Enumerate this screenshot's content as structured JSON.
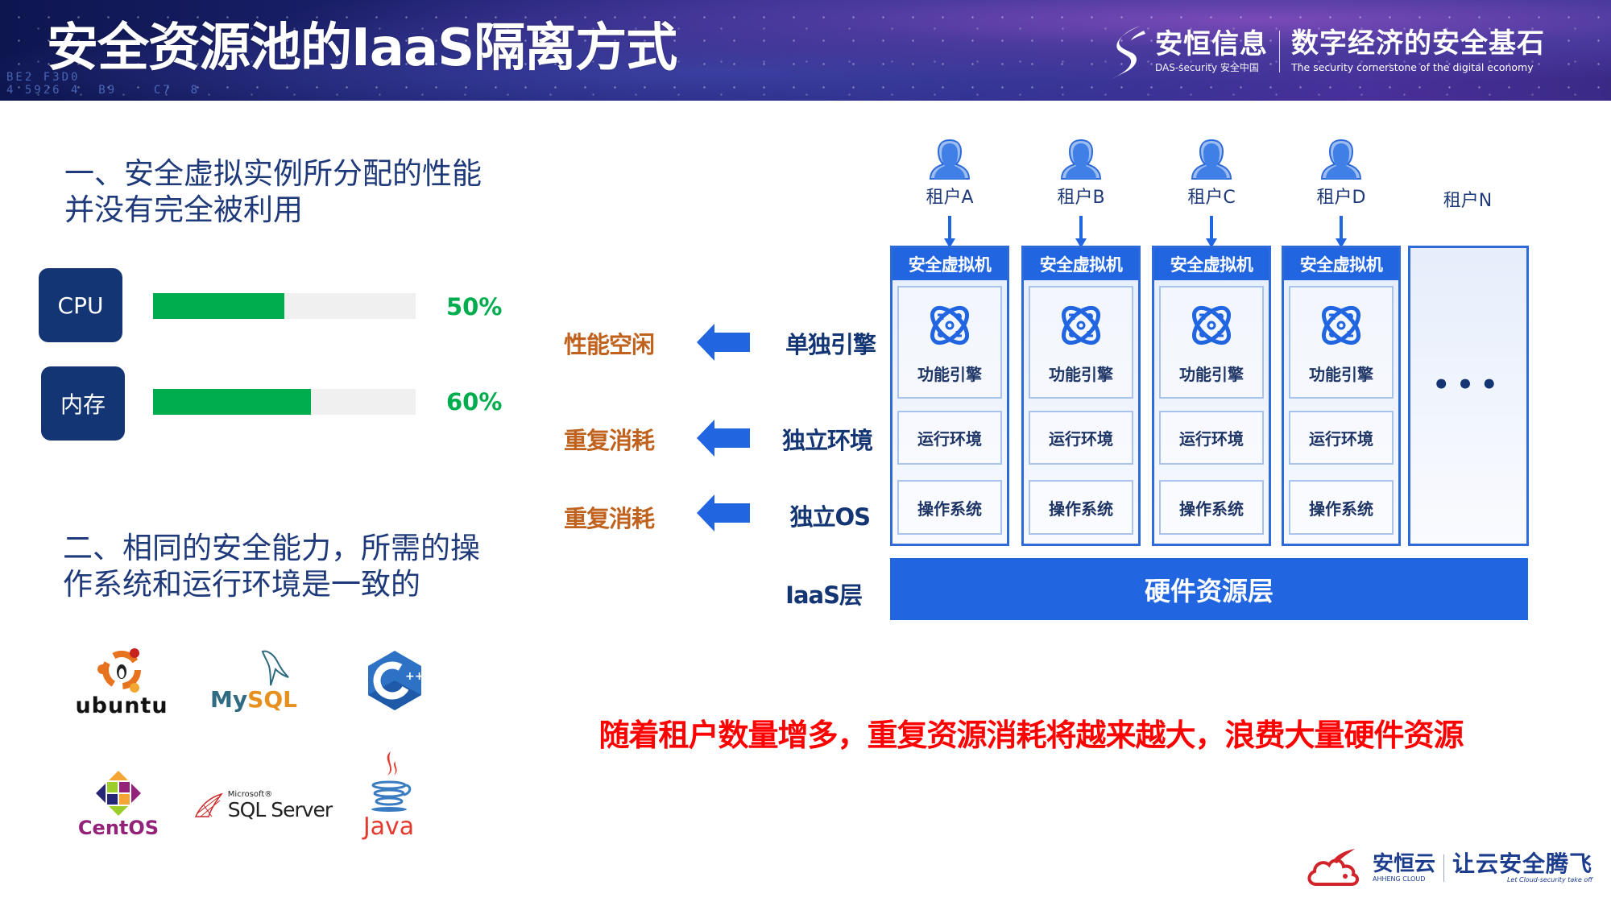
{
  "header": {
    "title": "安全资源池的IaaS隔离方式",
    "background_code": "BE2 F3D0\n4 5926 4  B9    C7  8",
    "brand": {
      "name": "安恒信息",
      "sub": "DAS-security 安全中国",
      "slogan": "数字经济的安全基石",
      "slogan_en": "The security cornerstone of the digital economy"
    }
  },
  "left": {
    "heading1": [
      "一、安全虚拟实例所分配的性能",
      "并没有完全被利用"
    ],
    "metrics": [
      {
        "label": "CPU",
        "value": 0.5,
        "value_text": "50%"
      },
      {
        "label": "内存",
        "value": 0.6,
        "value_text": "60%"
      }
    ],
    "heading2": [
      "二、相同的安全能力，所需的操",
      "作系统和运行环境是一致的"
    ],
    "logos": [
      {
        "name": "ubuntu",
        "text": "ubuntu"
      },
      {
        "name": "mysql",
        "text_a": "My",
        "text_b": "SQL"
      },
      {
        "name": "cpp",
        "text": "C",
        "sup": "++"
      },
      {
        "name": "centos",
        "text": "CentOS"
      },
      {
        "name": "sql-server",
        "small": "Microsoft®",
        "text": "SQL Server"
      },
      {
        "name": "java",
        "text": "Java"
      }
    ]
  },
  "middle": {
    "rows": [
      {
        "effect": "性能空闲",
        "cause": "单独引擎"
      },
      {
        "effect": "重复消耗",
        "cause": "独立环境"
      },
      {
        "effect": "重复消耗",
        "cause": "独立OS"
      }
    ],
    "iaas_label": "IaaS层"
  },
  "diagram": {
    "tenants": [
      {
        "label": "租户A",
        "has_vm": true
      },
      {
        "label": "租户B",
        "has_vm": true
      },
      {
        "label": "租户C",
        "has_vm": true
      },
      {
        "label": "租户D",
        "has_vm": true
      },
      {
        "label": "租户N",
        "has_vm": false
      }
    ],
    "vm_title": "安全虚拟机",
    "engine_label": "功能引擎",
    "runtime_label": "运行环境",
    "os_label": "操作系统",
    "more_indicator": "•••",
    "hardware_layer": "硬件资源层"
  },
  "note": "随着租户数量增多，重复资源消耗将越来越大，浪费大量硬件资源",
  "footer": {
    "cloud_name": "安恒云",
    "cloud_sub": "AHHENG CLOUD",
    "slogan": "让云安全腾飞",
    "slogan_en": "Let Cloud-security take off"
  },
  "colors": {
    "primary_blue": "#2166e0",
    "navy": "#143574",
    "green": "#00ad4e",
    "orange": "#c0621e",
    "red": "#ff0000"
  }
}
